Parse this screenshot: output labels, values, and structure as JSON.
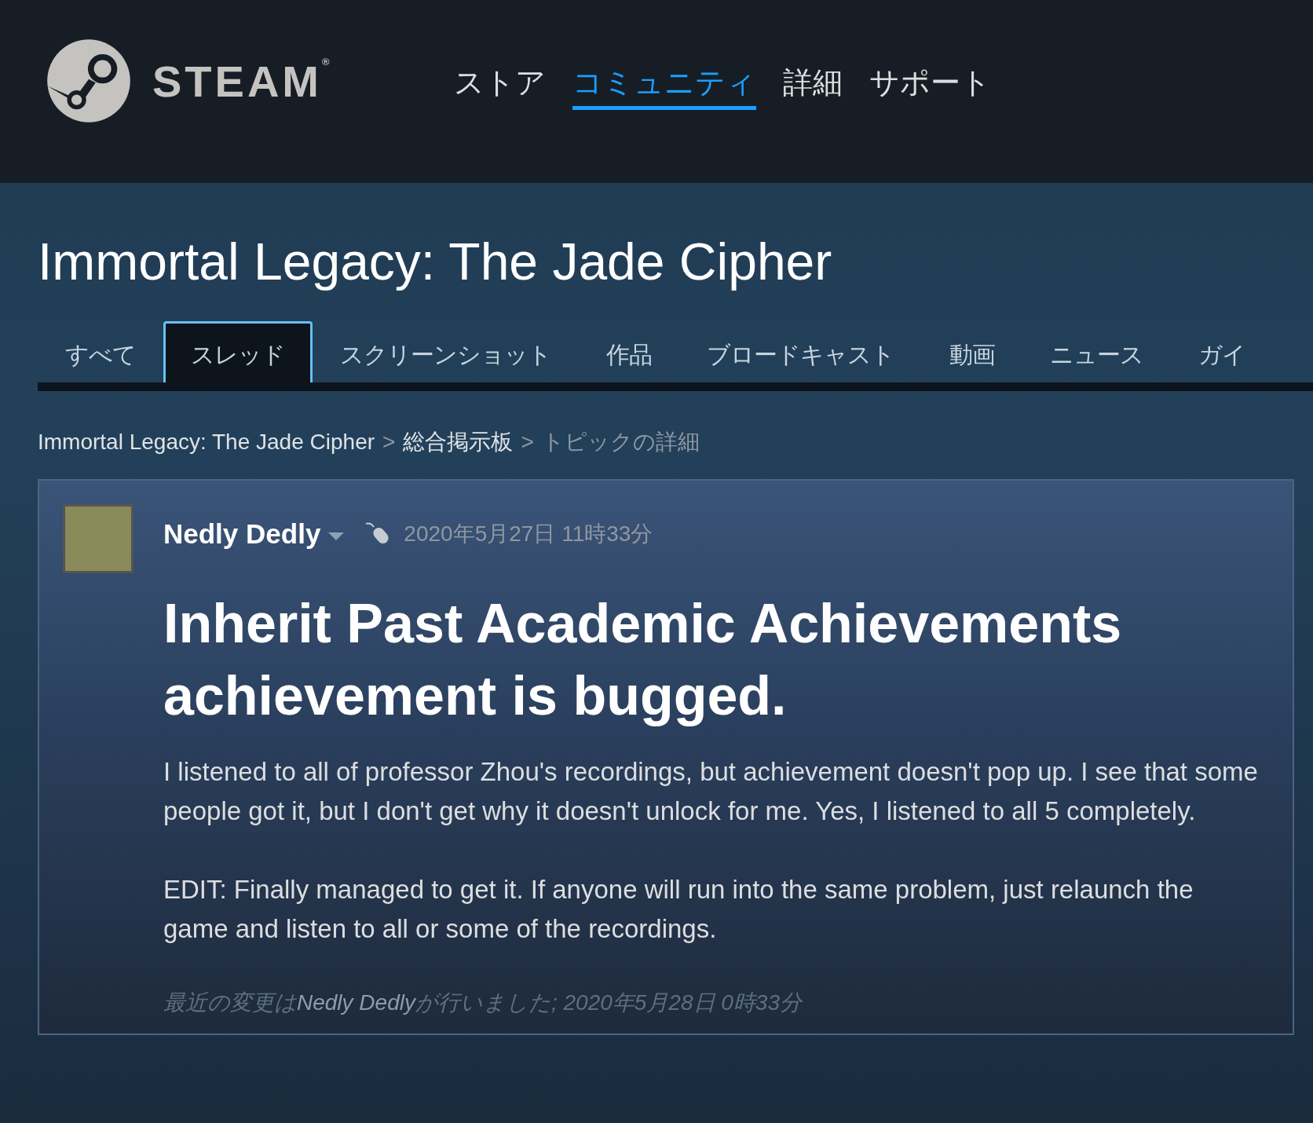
{
  "header": {
    "logo_text": "STEAM",
    "logo_mark": "®",
    "nav": [
      {
        "label": "ストア",
        "selected": false
      },
      {
        "label": "コミュニティ",
        "selected": true
      },
      {
        "label": "詳細",
        "selected": false
      },
      {
        "label": "サポート",
        "selected": false
      }
    ]
  },
  "game_title": "Immortal Legacy: The Jade Cipher",
  "tabs": [
    {
      "label": "すべて",
      "selected": false
    },
    {
      "label": "スレッド",
      "selected": true
    },
    {
      "label": "スクリーンショット",
      "selected": false
    },
    {
      "label": "作品",
      "selected": false
    },
    {
      "label": "ブロードキャスト",
      "selected": false
    },
    {
      "label": "動画",
      "selected": false
    },
    {
      "label": "ニュース",
      "selected": false
    },
    {
      "label": "ガイ",
      "selected": false
    }
  ],
  "breadcrumb": [
    {
      "label": "Immortal Legacy: The Jade Cipher"
    },
    {
      "label": "総合掲示板"
    },
    {
      "label": "トピックの詳細"
    }
  ],
  "breadcrumb_separator": ">",
  "post": {
    "author": "Nedly Dedly",
    "date": "2020年5月27日 11時33分",
    "title": "Inherit Past Academic Achievements achievement is bugged.",
    "paragraphs": [
      "I listened to all of professor Zhou's recordings, but achievement doesn't pop up. I see that some people got it, but I don't get why it doesn't unlock for me. Yes, I listened to all 5 completely.",
      "EDIT: Finally managed to get it. If anyone will run into the same problem, just relaunch the game and listen to all or some of the recordings."
    ],
    "edit_note": {
      "prefix": "最近の変更は",
      "author": "Nedly Dedly",
      "suffix": "が行いました; 2020年5月28日 0時33分"
    }
  }
}
